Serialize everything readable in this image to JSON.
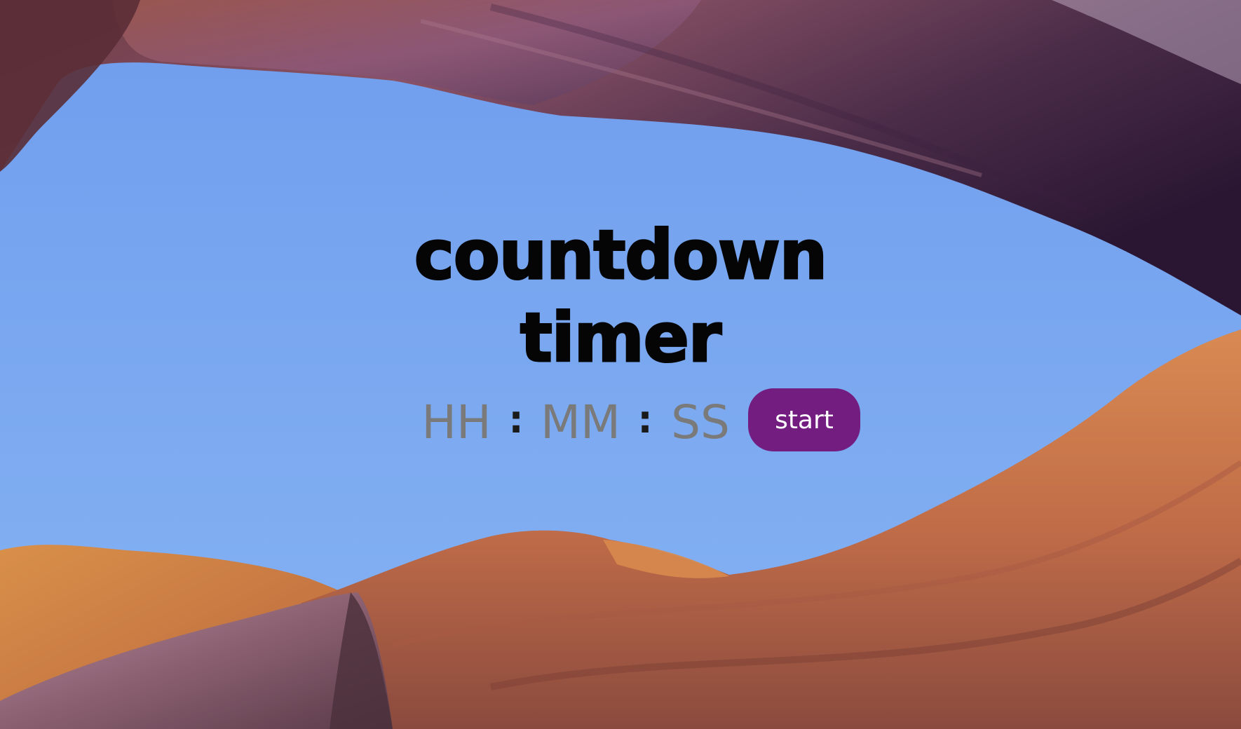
{
  "title": {
    "line1": "countdown",
    "line2": "timer"
  },
  "timer": {
    "hours_placeholder": "HH",
    "minutes_placeholder": "MM",
    "seconds_placeholder": "SS",
    "separator": ":"
  },
  "start_button": {
    "label": "start"
  },
  "colors": {
    "accent": "#741d80",
    "sky": "#7ea6ee",
    "placeholder": "#7a7a7a",
    "title": "#050505"
  }
}
